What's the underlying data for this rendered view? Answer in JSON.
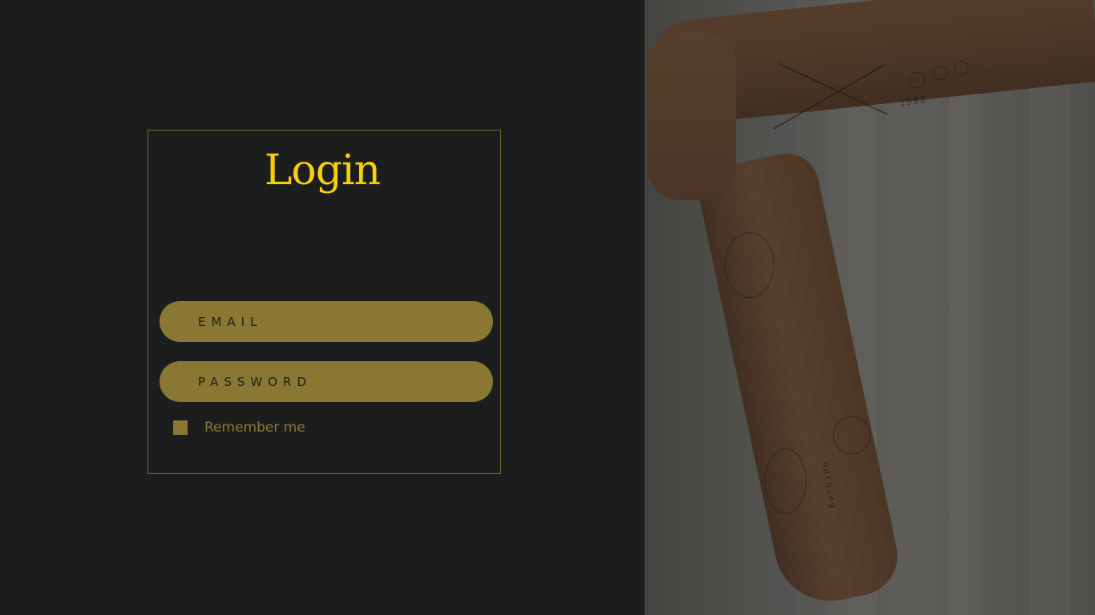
{
  "login": {
    "title": "Login",
    "email_placeholder": "EMAIL",
    "password_placeholder": "PASSWORD",
    "remember_label": "Remember me"
  },
  "colors": {
    "background": "#1b1e1d",
    "accent": "#f5cf0b",
    "field": "#8b7734",
    "border": "#7a6d2a"
  },
  "hero_image": {
    "tattoo_text_year": "1988",
    "tattoo_text_word": "nothing"
  }
}
